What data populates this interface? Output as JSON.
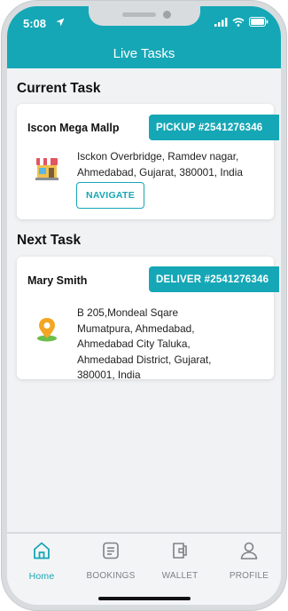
{
  "status": {
    "time": "5:08"
  },
  "header": {
    "title": "Live Tasks"
  },
  "current": {
    "section_title": "Current Task",
    "name": "Iscon Mega Mallp",
    "tag": "PICKUP #2541276346",
    "address_lines": [
      "Isckon Overbridge, Ramdev nagar,",
      "Ahmedabad, Gujarat, 380001, India"
    ],
    "button": "NAVIGATE"
  },
  "next": {
    "section_title": "Next Task",
    "name": "Mary Smith",
    "tag": "DELIVER #2541276346",
    "address_lines": [
      "B 205,Mondeal Sqare",
      "Mumatpura, Ahmedabad,",
      "Ahmedabad City Taluka,",
      "Ahmedabad District, Gujarat,",
      "380001, India"
    ]
  },
  "nav": {
    "items": [
      {
        "label": "Home",
        "icon": "home-icon",
        "active": true
      },
      {
        "label": "BOOKINGS",
        "icon": "bookings-icon",
        "active": false
      },
      {
        "label": "WALLET",
        "icon": "wallet-icon",
        "active": false
      },
      {
        "label": "PROFILE",
        "icon": "profile-icon",
        "active": false
      }
    ]
  },
  "colors": {
    "accent": "#15a7b6",
    "background": "#f1f2f4"
  }
}
